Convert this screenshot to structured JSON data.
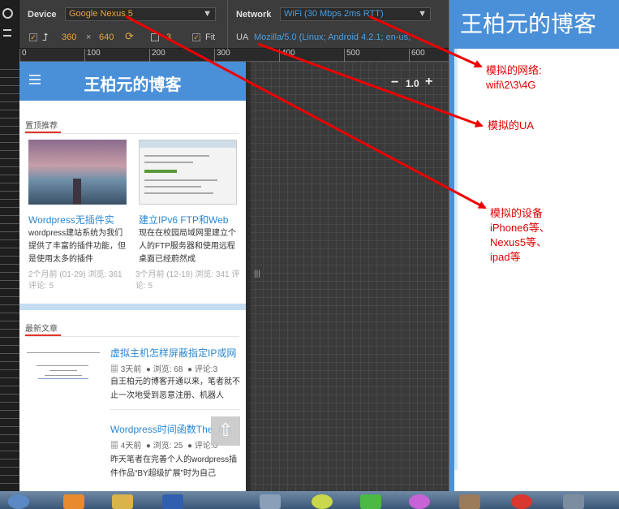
{
  "toolbar": {
    "device_label": "Device",
    "device_value": "Google Nexus 5",
    "width": "360",
    "times": "×",
    "height": "640",
    "pixel_ratio": "3",
    "fit_label": "Fit",
    "network_label": "Network",
    "network_value": "WiFi (30 Mbps 2ms RTT)",
    "ua_label": "UA",
    "ua_value": "Mozilla/5.0 (Linux; Android 4.2.1; en-us;"
  },
  "ruler": [
    "0",
    "100",
    "200",
    "300",
    "400",
    "500",
    "600"
  ],
  "zoom": {
    "minus": "−",
    "value": "1.0",
    "plus": "+"
  },
  "phone": {
    "site_title": "王柏元的博客",
    "top_section": "置顶推荐",
    "posts": [
      {
        "title": "Wordpress无插件实",
        "text": "wordpress建站系统为我们提供了丰富的插件功能，但是使用太多的插件",
        "meta": "2个月前 (01-29) 浏览: 361 评论: 5"
      },
      {
        "title": "建立IPv6 FTP和Web",
        "text": "现在在校园局域网里建立个人的FTP服务器和使用远程桌面已经蔚然成",
        "meta": "3个月前 (12-18) 浏览: 341 评论: 5"
      }
    ],
    "latest_section": "最新文章",
    "latest": [
      {
        "title": "虚拟主机怎样屏蔽指定IP或网",
        "time": "3天前",
        "views": "浏览: 68",
        "comments": "评论:3",
        "text": "自王柏元的博客开通以来，笔者就不止一次地受到恶意注册、机器人"
      },
      {
        "title": "Wordpress时间函数The_tim",
        "time": "4天前",
        "views": "浏览: 25",
        "comments": "评论:0",
        "text": "昨天笔者在完善个人的wordpress插件作品“BY超级扩展”时为自己"
      }
    ]
  },
  "right_panel": {
    "header": "王柏元的博客",
    "note_network": "模拟的网络:\nwifi\\2\\3\\4G",
    "note_ua": "模拟的UA",
    "note_device": "模拟的设备\niPhone6等、\nNexus5等、\nipad等"
  },
  "colors": {
    "accent": "#4a90d9",
    "annotation": "#dd0000",
    "orange": "#e8a33d"
  }
}
